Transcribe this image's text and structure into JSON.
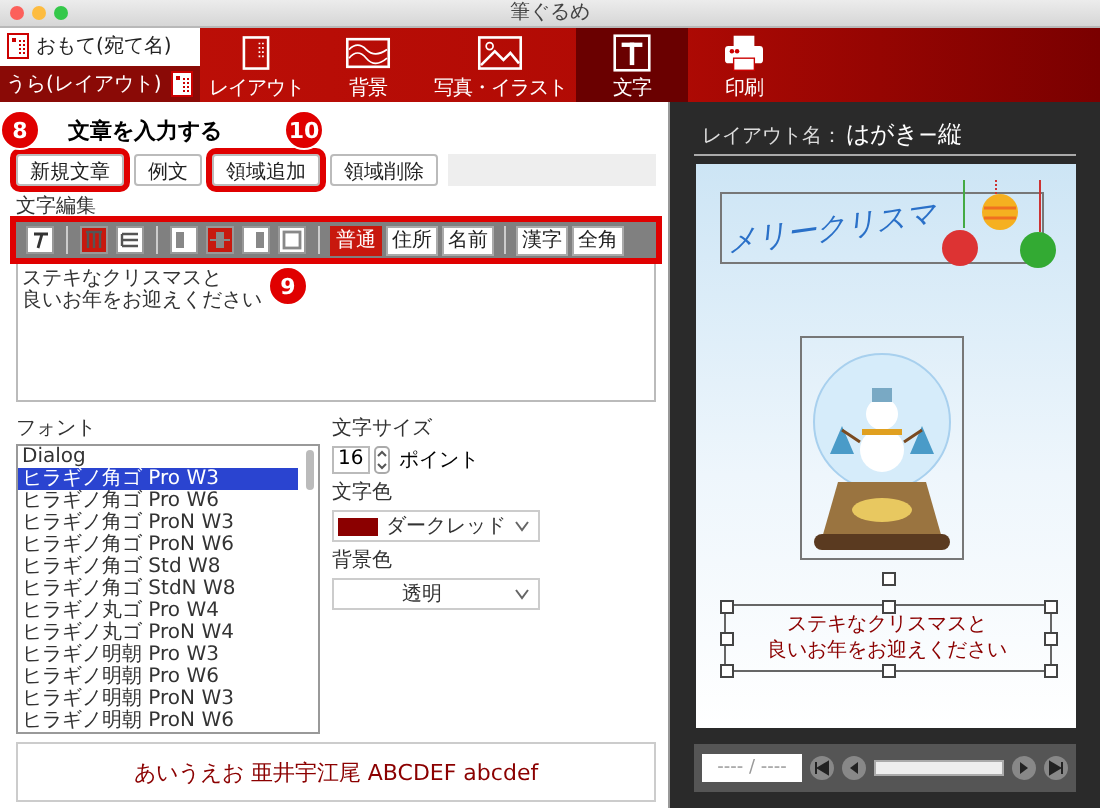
{
  "window": {
    "title": "筆ぐるめ"
  },
  "toolbar": {
    "sides": [
      {
        "label": "おもて(宛て名)",
        "selected": false
      },
      {
        "label": "うら(レイアウト)",
        "selected": true
      }
    ],
    "tabs": [
      {
        "label": "レイアウト",
        "kind": "layout",
        "selected": false
      },
      {
        "label": "背景",
        "kind": "background",
        "selected": false
      },
      {
        "label": "写真・イラスト",
        "kind": "photo",
        "selected": false
      },
      {
        "label": "文字",
        "kind": "text",
        "selected": true
      },
      {
        "label": "印刷",
        "kind": "print",
        "selected": false
      }
    ]
  },
  "editor": {
    "heading": "文章を入力する",
    "buttons": [
      {
        "label": "新規文章",
        "highlighted": true,
        "callout": "8"
      },
      {
        "label": "例文",
        "highlighted": false
      },
      {
        "label": "領域追加",
        "highlighted": true,
        "callout": "10"
      },
      {
        "label": "領域削除",
        "highlighted": false
      }
    ],
    "format_label": "文字編集",
    "format_highlighted": true,
    "format_callout": "9",
    "format_groups": [
      {
        "items": [
          {
            "kind": "style",
            "selected": false
          }
        ]
      },
      {
        "items": [
          {
            "kind": "vertical",
            "selected": true
          },
          {
            "kind": "horizontal",
            "selected": false
          }
        ]
      },
      {
        "items": [
          {
            "kind": "left",
            "selected": false
          },
          {
            "kind": "center",
            "selected": true
          },
          {
            "kind": "right",
            "selected": false
          },
          {
            "kind": "justify",
            "selected": false
          }
        ]
      },
      {
        "items": [
          {
            "kind": "word",
            "label": "普通",
            "selected": true
          },
          {
            "kind": "word",
            "label": "住所",
            "selected": false
          },
          {
            "kind": "word",
            "label": "名前",
            "selected": false
          }
        ]
      },
      {
        "items": [
          {
            "kind": "word",
            "label": "漢字",
            "selected": false
          },
          {
            "kind": "word",
            "label": "全角",
            "selected": false
          }
        ]
      }
    ],
    "text_lines": [
      "ステキなクリスマスと",
      "良いお年をお迎えください"
    ]
  },
  "font": {
    "label": "フォント",
    "items": [
      {
        "name": "Dialog",
        "selected": false
      },
      {
        "name": "ヒラギノ角ゴ Pro W3",
        "selected": true
      },
      {
        "name": "ヒラギノ角ゴ Pro W6",
        "selected": false
      },
      {
        "name": "ヒラギノ角ゴ ProN W3",
        "selected": false
      },
      {
        "name": "ヒラギノ角ゴ ProN W6",
        "selected": false
      },
      {
        "name": "ヒラギノ角ゴ Std W8",
        "selected": false
      },
      {
        "name": "ヒラギノ角ゴ StdN W8",
        "selected": false
      },
      {
        "name": "ヒラギノ丸ゴ Pro W4",
        "selected": false
      },
      {
        "name": "ヒラギノ丸ゴ ProN W4",
        "selected": false
      },
      {
        "name": "ヒラギノ明朝 Pro W3",
        "selected": false
      },
      {
        "name": "ヒラギノ明朝 Pro W6",
        "selected": false
      },
      {
        "name": "ヒラギノ明朝 ProN W3",
        "selected": false
      },
      {
        "name": "ヒラギノ明朝 ProN W6",
        "selected": false
      }
    ]
  },
  "size": {
    "label": "文字サイズ",
    "value": "16",
    "unit": "ポイント"
  },
  "text_color": {
    "label": "文字色",
    "value": "ダークレッド",
    "color": "#8b0000"
  },
  "background_color": {
    "label": "背景色",
    "value": "透明"
  },
  "sample": "あいうえお 亜井宇江尾 ABCDEF abcdef",
  "preview": {
    "layout_label": "レイアウト名：",
    "layout_name": "はがき−縦",
    "title": "メリークリスマ",
    "message": [
      "ステキなクリスマスと",
      "良いお年をお迎えください"
    ],
    "pager": "---- / ----",
    "slider": {
      "level": 1
    }
  }
}
